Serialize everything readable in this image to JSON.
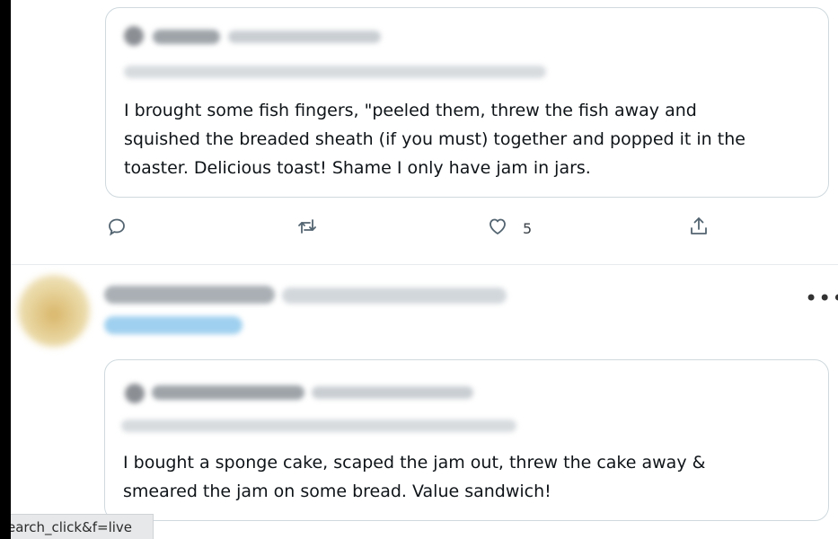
{
  "quoted_tweet_1": {
    "text": "I brought some fish fingers, \"peeled them, threw the fish away and\nsquished the breaded sheath (if you must) together and popped it in the\ntoaster. Delicious toast! Shame I only have jam in jars."
  },
  "actions": {
    "reply_icon": "reply-icon",
    "retweet_icon": "retweet-icon",
    "like_icon": "heart-icon",
    "like_count": "5",
    "share_icon": "share-icon"
  },
  "tweet_2": {
    "more_label": "•••"
  },
  "quoted_tweet_2": {
    "text": "I bought a sponge cake, scaped the jam out, threw the cake away &\nsmeared the jam on some bread. Value sandwich!"
  },
  "status_bar": {
    "url_fragment": "earch_click&f=live"
  }
}
